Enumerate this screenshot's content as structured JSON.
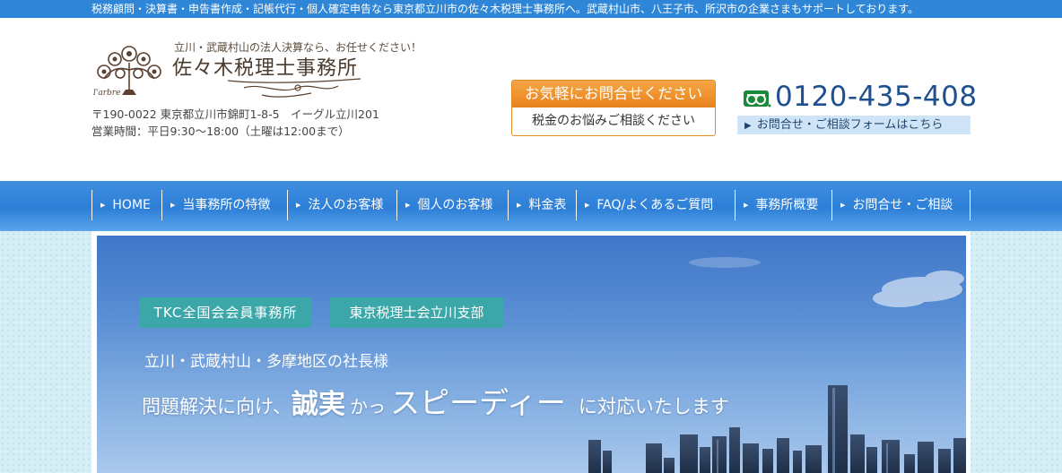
{
  "topbar": {
    "text": "税務顧問・決算書・申告書作成・記帳代行・個人確定申告なら東京都立川市の佐々木税理士事務所へ。武蔵村山市、八王子市、所沢市の企業さまもサポートしております。"
  },
  "logo": {
    "tagline": "立川・武蔵村山の法人決算なら、お任せください！",
    "name": "佐々木税理士事務所",
    "mark_text": "l'arbre"
  },
  "address": {
    "line1": "〒190-0022 東京都立川市錦町1-8-5　イーグル立川201",
    "line2": "営業時間：平日9:30～18:00（土曜は12:00まで）"
  },
  "contact_box": {
    "title": "お気軽にお問合せください",
    "subtitle": "税金のお悩みご相談ください",
    "accent": "#e9821d"
  },
  "phone": {
    "icon": "freedial-icon",
    "number": "0120-435-408",
    "form_link": "お問合せ・ご相談フォームはこちら"
  },
  "nav": {
    "items": [
      {
        "label": "HOME"
      },
      {
        "label": "当事務所の特徴"
      },
      {
        "label": "法人のお客様"
      },
      {
        "label": "個人のお客様"
      },
      {
        "label": "料金表"
      },
      {
        "label": "FAQ/よくあるご質問"
      },
      {
        "label": "事務所概要"
      },
      {
        "label": "お問合せ・ご相談"
      }
    ],
    "color": "#2d7fd7"
  },
  "hero": {
    "badge1": "TKC全国会会員事務所",
    "badge2": "東京税理士会立川支部",
    "line1": "立川・武蔵村山・多摩地区の社長様",
    "line2_a": "問題解決に向け、",
    "line2_b": "誠実",
    "line2_c": "かっ",
    "line2_d": "スピーディー",
    "line2_e": "に対応いたします",
    "badge_color": "#3ca7a9"
  }
}
